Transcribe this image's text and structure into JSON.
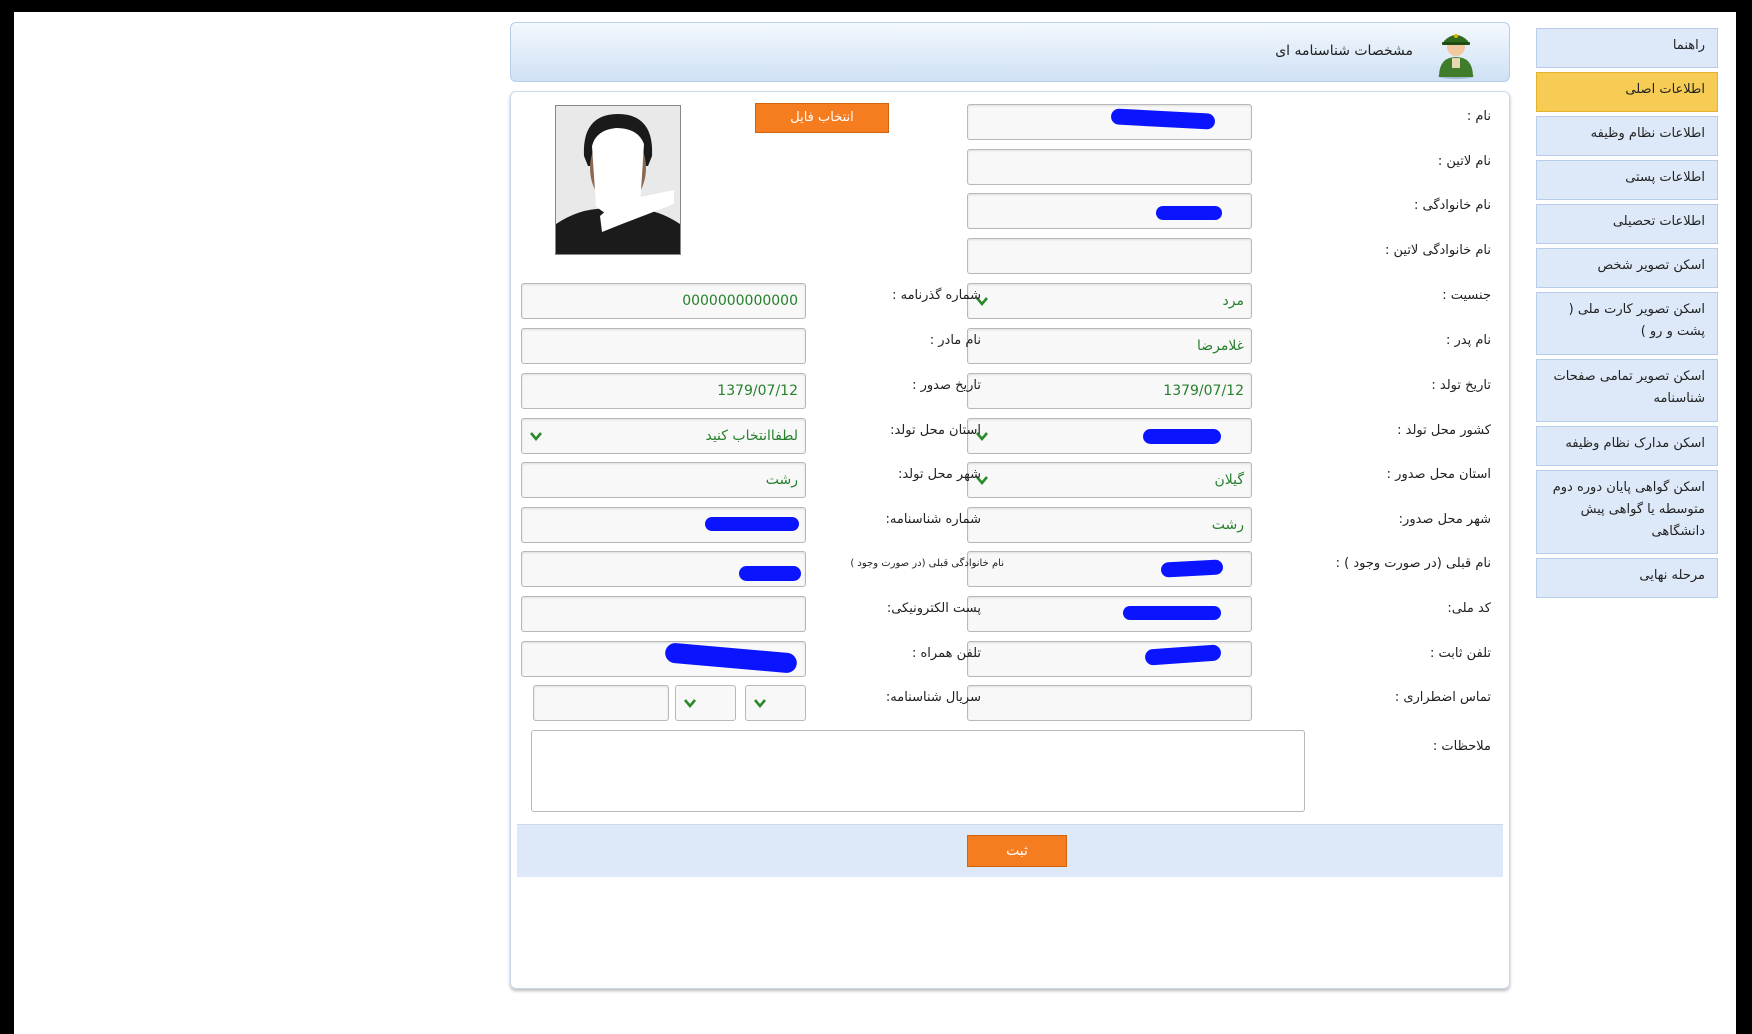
{
  "header": {
    "title": "مشخصات شناسنامه ای",
    "icon": "soldier-icon"
  },
  "sidebar": {
    "items": [
      {
        "label": "راهنما"
      },
      {
        "label": "اطلاعات اصلی"
      },
      {
        "label": "اطلاعات نظام وظیفه"
      },
      {
        "label": "اطلاعات پستی"
      },
      {
        "label": "اطلاعات تحصیلی"
      },
      {
        "label": "اسکن تصویر شخص"
      },
      {
        "label": "اسکن تصویر کارت ملی ( پشت و رو )"
      },
      {
        "label": "اسکن تصویر تمامی صفحات شناسنامه"
      },
      {
        "label": "اسکن مدارک نظام وظیفه"
      },
      {
        "label": "اسکن گواهی پایان دوره دوم متوسطه یا گواهی پیش دانشگاهی"
      },
      {
        "label": "مرحله نهایی"
      }
    ],
    "active_index": 1
  },
  "photo": {
    "file_button": "انتخاب فایل"
  },
  "form": {
    "first_name": {
      "label": "نام :",
      "value": ""
    },
    "latin_name": {
      "label": "نام لاتین :",
      "value": ""
    },
    "last_name": {
      "label": "نام خانوادگی :",
      "value": ""
    },
    "latin_last_name": {
      "label": "نام خانوادگی لاتین :",
      "value": ""
    },
    "gender": {
      "label": "جنسیت :",
      "value": "مرد"
    },
    "passport_number": {
      "label": "شماره گذرنامه :",
      "value": "0000000000000"
    },
    "father_name": {
      "label": "نام پدر :",
      "value": "غلامرضا"
    },
    "mother_name": {
      "label": "نام مادر :",
      "value": ""
    },
    "birth_date": {
      "label": "تاریخ تولد :",
      "value": "1379/07/12"
    },
    "issue_date": {
      "label": "تاریخ صدور :",
      "value": "1379/07/12"
    },
    "birth_country": {
      "label": "کشور محل تولد :",
      "value": ""
    },
    "birth_province": {
      "label": "استان محل تولد:",
      "value": "لطفاانتخاب کنید"
    },
    "issue_province": {
      "label": "استان محل صدور :",
      "value": "گیلان"
    },
    "birth_city": {
      "label": "شهر محل تولد:",
      "value": "رشت"
    },
    "issue_city": {
      "label": "شهر محل صدور:",
      "value": "رشت"
    },
    "id_number": {
      "label": "شماره شناسنامه:",
      "value": ""
    },
    "previous_name": {
      "label": "نام قبلی (در صورت وجود ) :",
      "value": ""
    },
    "previous_last_name": {
      "label": "نام خانوادگی قبلی (در صورت وجود )",
      "value": ""
    },
    "national_code": {
      "label": "کد ملی:",
      "value": ""
    },
    "email": {
      "label": "پست الکترونیکی:",
      "value": ""
    },
    "landline": {
      "label": "تلفن ثابت :",
      "value": ""
    },
    "mobile": {
      "label": "تلفن همراه :",
      "value": ""
    },
    "emergency_contact": {
      "label": "تماس اضطراری :",
      "value": ""
    },
    "id_serial": {
      "label": "سریال شناسنامه:",
      "value": ""
    },
    "notes": {
      "label": "ملاحظات :",
      "value": ""
    }
  },
  "submit": {
    "label": "ثبت"
  },
  "colors": {
    "accent_orange": "#f57c1f",
    "active_tab": "#f7cc55",
    "sidebar_bg": "#dde9f8",
    "value_green": "#27802d",
    "redaction_blue": "#0a14ff"
  }
}
